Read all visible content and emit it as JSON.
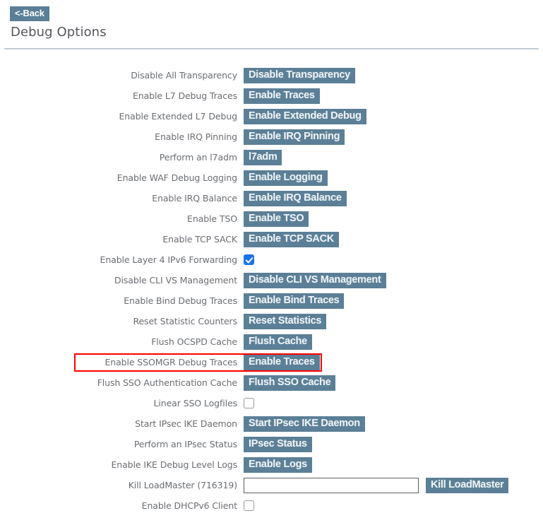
{
  "header": {
    "back_label": "<-Back",
    "title": "Debug Options"
  },
  "colors": {
    "button_bg": "#5b7f96",
    "button_text": "#eef3f7",
    "label_text": "#6a6d72",
    "title_text": "#54565b",
    "divider": "#b7c4ce",
    "checkbox_checked": "#1a73e8",
    "highlight_border": "#ff0000"
  },
  "highlight": {
    "target_row_index": 14,
    "note": "red rectangle drawn around the Enable SSOMGR Debug Traces row"
  },
  "rows": [
    {
      "label": "Disable All Transparency",
      "control": "button",
      "button": "Disable Transparency"
    },
    {
      "label": "Enable L7 Debug Traces",
      "control": "button",
      "button": "Enable Traces"
    },
    {
      "label": "Enable Extended L7 Debug",
      "control": "button",
      "button": "Enable Extended Debug"
    },
    {
      "label": "Enable IRQ Pinning",
      "control": "button",
      "button": "Enable IRQ Pinning"
    },
    {
      "label": "Perform an l7adm",
      "control": "button",
      "button": "l7adm"
    },
    {
      "label": "Enable WAF Debug Logging",
      "control": "button",
      "button": "Enable Logging"
    },
    {
      "label": "Enable IRQ Balance",
      "control": "button",
      "button": "Enable IRQ Balance"
    },
    {
      "label": "Enable TSO",
      "control": "button",
      "button": "Enable TSO"
    },
    {
      "label": "Enable TCP SACK",
      "control": "button",
      "button": "Enable TCP SACK"
    },
    {
      "label": "Enable Layer 4 IPv6 Forwarding",
      "control": "checkbox",
      "checked": true
    },
    {
      "label": "Disable CLI VS Management",
      "control": "button",
      "button": "Disable CLI VS Management"
    },
    {
      "label": "Enable Bind Debug Traces",
      "control": "button",
      "button": "Enable Bind Traces"
    },
    {
      "label": "Reset Statistic Counters",
      "control": "button",
      "button": "Reset Statistics"
    },
    {
      "label": "Flush OCSPD Cache",
      "control": "button",
      "button": "Flush Cache"
    },
    {
      "label": "Enable SSOMGR Debug Traces",
      "control": "button",
      "button": "Enable Traces"
    },
    {
      "label": "Flush SSO Authentication Cache",
      "control": "button",
      "button": "Flush SSO Cache"
    },
    {
      "label": "Linear SSO Logfiles",
      "control": "checkbox",
      "checked": false
    },
    {
      "label": "Start IPsec IKE Daemon",
      "control": "button",
      "button": "Start IPsec IKE Daemon"
    },
    {
      "label": "Perform an IPsec Status",
      "control": "button",
      "button": "IPsec Status"
    },
    {
      "label": "Enable IKE Debug Level Logs",
      "control": "button",
      "button": "Enable Logs"
    },
    {
      "label": "Kill LoadMaster (716319)",
      "control": "input-button",
      "value": "",
      "placeholder": "",
      "button": "Kill LoadMaster"
    },
    {
      "label": "Enable DHCPv6 Client",
      "control": "checkbox",
      "checked": false
    }
  ]
}
